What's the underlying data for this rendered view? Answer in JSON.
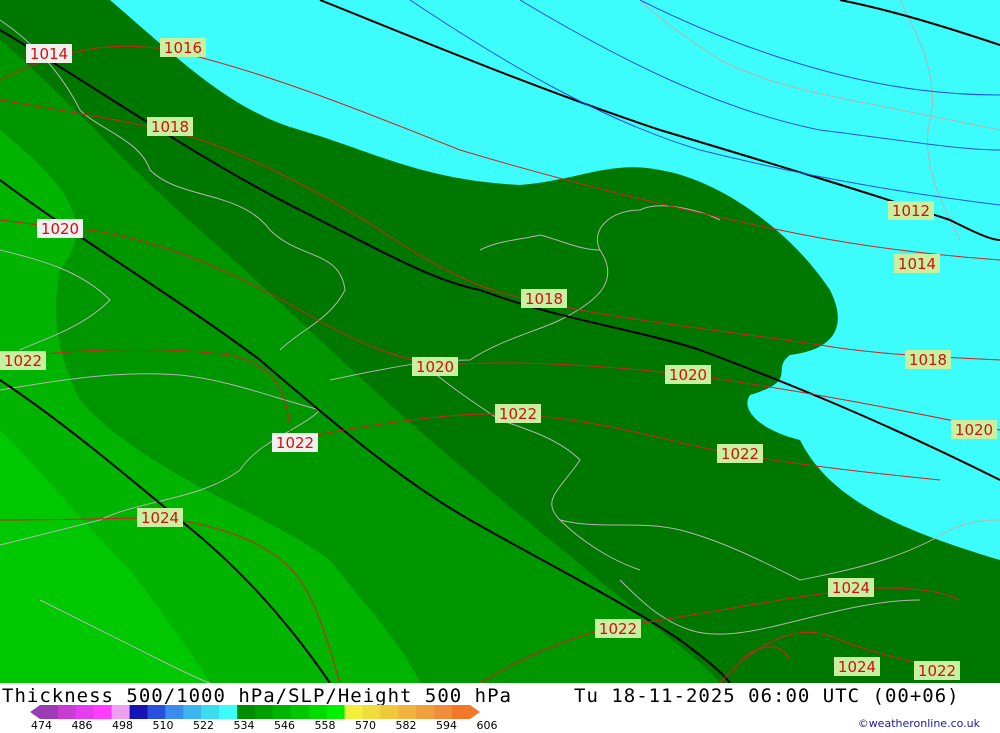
{
  "map": {
    "pressure_labels": [
      {
        "id": "p1",
        "text": "1014"
      },
      {
        "id": "p2",
        "text": "1016"
      },
      {
        "id": "p3",
        "text": "1018"
      },
      {
        "id": "p4",
        "text": "1020"
      },
      {
        "id": "p5",
        "text": "1022"
      },
      {
        "id": "p6",
        "text": "1024"
      },
      {
        "id": "p7",
        "text": "1018"
      },
      {
        "id": "p8",
        "text": "1020"
      },
      {
        "id": "p9",
        "text": "1022"
      },
      {
        "id": "p10",
        "text": "1022"
      },
      {
        "id": "p11",
        "text": "1020"
      },
      {
        "id": "p12",
        "text": "1022"
      },
      {
        "id": "p13",
        "text": "1012"
      },
      {
        "id": "p14",
        "text": "1014"
      },
      {
        "id": "p15",
        "text": "1018"
      },
      {
        "id": "p16",
        "text": "1020"
      },
      {
        "id": "p17",
        "text": "1024"
      },
      {
        "id": "p18",
        "text": "1022"
      },
      {
        "id": "p19",
        "text": "1024"
      },
      {
        "id": "p20",
        "text": "1022"
      }
    ],
    "colors": {
      "cyan": "#3cfcfc",
      "dark_green": "#007800",
      "mid_green": "#009600",
      "light_green": "#00b400",
      "bright_green": "#00c800",
      "isobar": "#d22020",
      "height": "#000000",
      "border": "#b4b4b4"
    }
  },
  "footer": {
    "title": "Thickness 500/1000 hPa/SLP/Height 500 hPa",
    "datetime": "Tu 18-11-2025 06:00 UTC (00+06)",
    "credit": "©weatheronline.co.uk",
    "scale_ticks": [
      "474",
      "486",
      "498",
      "510",
      "522",
      "534",
      "546",
      "558",
      "570",
      "582",
      "594",
      "606"
    ],
    "scale_colors": [
      "#9b3cb4",
      "#c83cd2",
      "#e63cf0",
      "#ff3cff",
      "#f0a0f0",
      "#1414b4",
      "#2850dc",
      "#3c8cf0",
      "#3cb4f0",
      "#3cdcf0",
      "#3cfcfc",
      "#008c00",
      "#00a000",
      "#00b400",
      "#00c800",
      "#00dc00",
      "#00f000",
      "#f0f03c",
      "#f0dc3c",
      "#f0c83c",
      "#f0b43c",
      "#f0a03c",
      "#f08c3c",
      "#f07828"
    ]
  }
}
